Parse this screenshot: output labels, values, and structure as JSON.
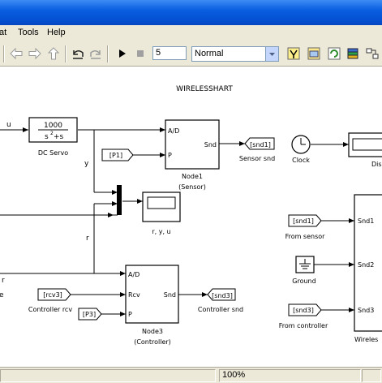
{
  "menu": {
    "items": [
      "at",
      "Tools",
      "Help"
    ]
  },
  "toolbar": {
    "stop_time": "5",
    "sim_mode": "Normal",
    "icons": [
      "back-arrow-icon",
      "forward-arrow-icon",
      "up-arrow-icon",
      "undo-icon",
      "redo-icon",
      "run-icon",
      "stop-icon",
      "build-icon",
      "update-icon",
      "refresh-icon",
      "library-browser-icon",
      "model-explorer-icon"
    ]
  },
  "diagram": {
    "title": "WIRELESSHART",
    "signals": {
      "u": "u",
      "y": "y",
      "r_mid": "r",
      "r_left": "r",
      "e_left": "e"
    },
    "dc_servo": {
      "num": "1000",
      "den_base": "s",
      "den_exp": "2",
      "den_rest": "+s",
      "label": "DC Servo"
    },
    "p1_tag": "[P1]",
    "node1": {
      "port_ad": "A/D",
      "port_p": "P",
      "port_snd": "Snd",
      "label1": "Node1",
      "label2": "(Sensor)"
    },
    "snd1_goto": "[snd1]",
    "sensor_snd_label": "Sensor snd",
    "clock_label": "Clock",
    "display_label": "Dis",
    "scope_label": "r, y, u",
    "from_sensor": {
      "tag": "[snd1]",
      "label": "From sensor"
    },
    "ground_label": "Ground",
    "from_controller": {
      "tag": "[snd3]",
      "label": "From controller"
    },
    "wireless": {
      "port1": "Snd1",
      "port2": "Snd2",
      "port3": "Snd3",
      "label": "Wireles"
    },
    "node3": {
      "port_ad": "A/D",
      "port_rcv": "Rcv",
      "port_p": "P",
      "port_snd": "Snd",
      "label1": "Node3",
      "label2": "(Controller)"
    },
    "rcv3_tag": "[rcv3]",
    "controller_rcv_label": "Controller rcv",
    "p3_tag": "[P3]",
    "snd3_goto": "[snd3]",
    "controller_snd_label": "Controller  snd"
  },
  "status": {
    "zoom": "100%"
  }
}
